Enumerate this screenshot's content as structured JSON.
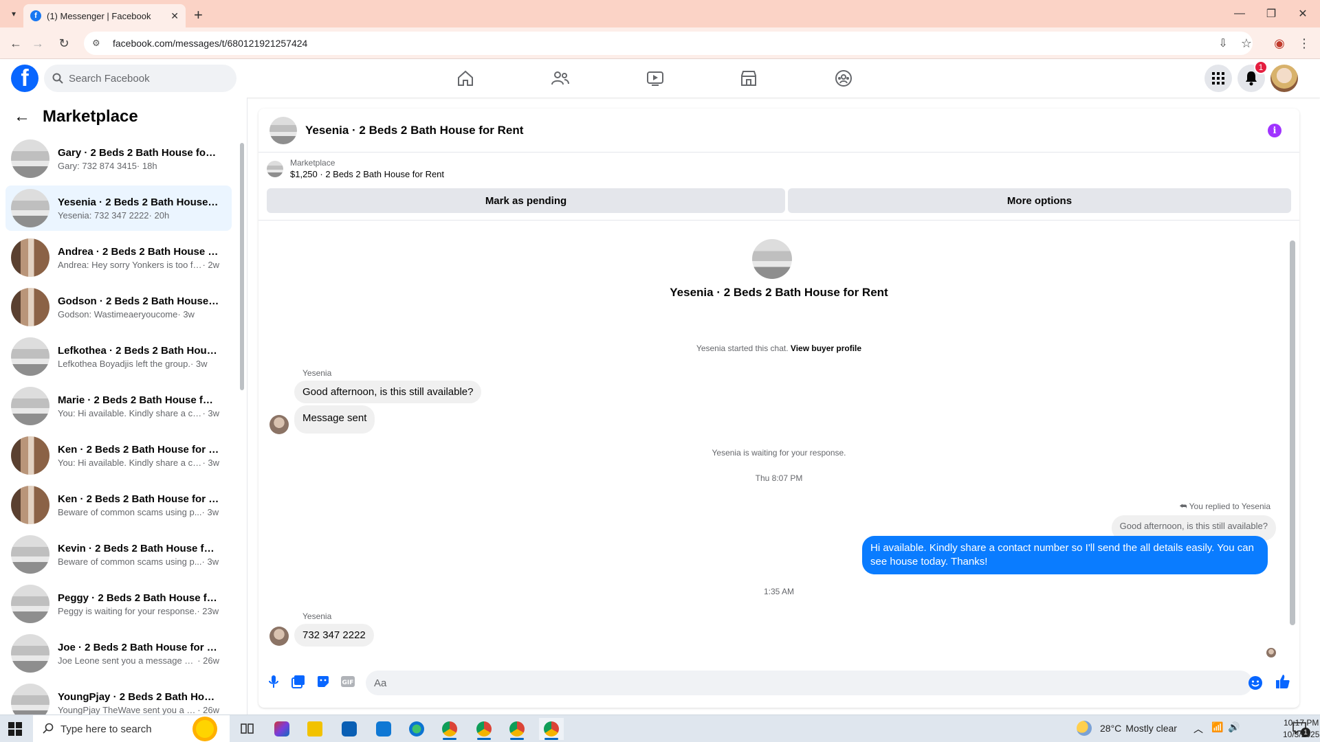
{
  "browser": {
    "tab_title": "(1) Messenger | Facebook",
    "url": "facebook.com/messages/t/680121921257424"
  },
  "fb": {
    "search_placeholder": "Search Facebook",
    "notifications_count": "1"
  },
  "sidebar": {
    "title": "Marketplace",
    "conversations": [
      {
        "name": "Gary · 2 Beds 2 Bath House for R...",
        "preview": "Gary: 732 874 3415",
        "meta": " · 18h",
        "thumb": "room"
      },
      {
        "name": "Yesenia · 2 Beds 2 Bath House fo...",
        "preview": "Yesenia: 732 347 2222",
        "meta": " · 20h",
        "thumb": "room",
        "selected": true
      },
      {
        "name": "Andrea · 2 Beds 2 Bath House fo...",
        "preview": "Andrea: Hey sorry Yonkers is too fa...",
        "meta": " · 2w",
        "thumb": "hall"
      },
      {
        "name": "Godson · 2 Beds 2 Bath House f...",
        "preview": "Godson: Wastimeaeryoucome",
        "meta": " · 3w",
        "thumb": "hall"
      },
      {
        "name": "Lefkothea · 2 Beds 2 Bath House...",
        "preview": "Lefkothea Boyadjis left the group.",
        "meta": " · 3w",
        "thumb": "room"
      },
      {
        "name": "Marie · 2 Beds 2 Bath House for ...",
        "preview": "You: Hi available. Kindly share a co...",
        "meta": " · 3w",
        "thumb": "room"
      },
      {
        "name": "Ken · 2 Beds 2 Bath House for R...",
        "preview": "You: Hi available. Kindly share a co...",
        "meta": " · 3w",
        "thumb": "hall"
      },
      {
        "name": "Ken · 2 Beds 2 Bath House for R...",
        "preview": "Beware of common scams using p...",
        "meta": " · 3w",
        "thumb": "hall"
      },
      {
        "name": "Kevin · 2 Beds 2 Bath House for ...",
        "preview": "Beware of common scams using p...",
        "meta": " · 3w",
        "thumb": "room"
      },
      {
        "name": "Peggy · 2 Beds 2 Bath House for...",
        "preview": "Peggy is waiting for your response.",
        "meta": " · 23w",
        "thumb": "room"
      },
      {
        "name": "Joe · 2 Beds 2 Bath House for Re...",
        "preview": "Joe Leone sent you a message ab...",
        "meta": " · 26w",
        "thumb": "room"
      },
      {
        "name": "YoungPjay · 2 Beds 2 Bath Hous...",
        "preview": "YoungPjay TheWave sent you a m...",
        "meta": " · 26w",
        "thumb": "room"
      }
    ]
  },
  "chat": {
    "title": "Yesenia · 2 Beds 2 Bath House for Rent",
    "listing_source": "Marketplace",
    "listing_detail": "$1,250 · 2 Beds 2 Bath House for Rent",
    "mark_pending": "Mark as pending",
    "more_options": "More options",
    "intro_title": "Yesenia · 2 Beds 2 Bath House for Rent",
    "started_text": "Yesenia started this chat.",
    "view_profile": "View buyer profile",
    "sender1": "Yesenia",
    "msg1": "Good afternoon, is this still available?",
    "msg2": "Message sent",
    "waiting": "Yesenia is waiting for your response.",
    "time1": "Thu 8:07 PM",
    "replied_to": "You replied to Yesenia",
    "quoted": "Good afternoon, is this still available?",
    "my_msg": "Hi available. Kindly share a contact number so I'll send the all details easily. You can see house today. Thanks!",
    "time2": "1:35 AM",
    "sender2": "Yesenia",
    "msg3": "732 347 2222",
    "composer_placeholder": "Aa"
  },
  "taskbar": {
    "search_placeholder": "Type here to search",
    "temp": "28°C",
    "weather": "Mostly clear",
    "time": "10:17 PM",
    "date": "10/3/2025",
    "notif_count": "1"
  },
  "colors": {
    "fb_blue": "#0866ff",
    "outgoing_bubble": "#0a7cff",
    "info_purple": "#a033ff",
    "badge_red": "#e41e3f",
    "tab_strip": "#fbd3c6"
  }
}
